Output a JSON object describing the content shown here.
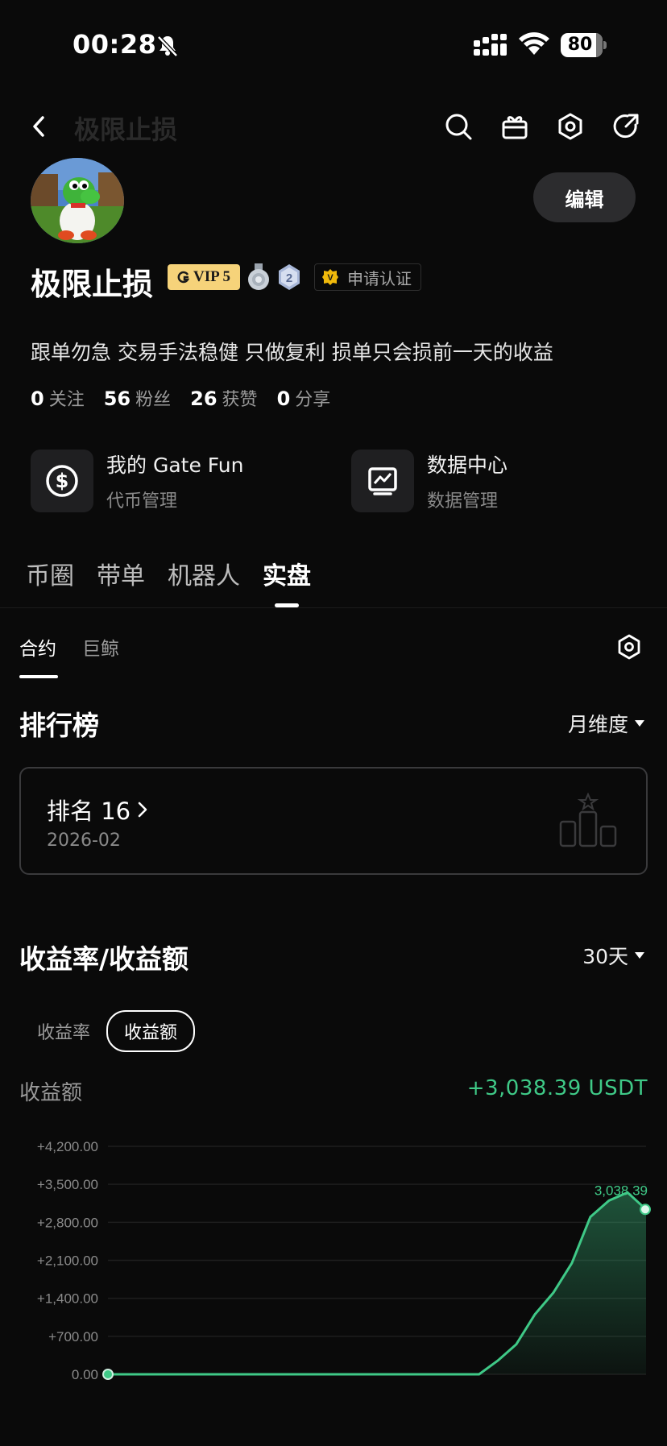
{
  "status_bar": {
    "time": "00:28",
    "battery": "80"
  },
  "header": {
    "title": "极限止损"
  },
  "profile": {
    "name": "极限止损",
    "vip_label": "VIP 5",
    "medal_2": "2",
    "verify_label": "申请认证",
    "edit_label": "编辑",
    "bio": "跟单勿急 交易手法稳健 只做复利 损单只会损前一天的收益",
    "stats": [
      {
        "num": "0",
        "label": "关注"
      },
      {
        "num": "56",
        "label": "粉丝"
      },
      {
        "num": "26",
        "label": "获赞"
      },
      {
        "num": "0",
        "label": "分享"
      }
    ]
  },
  "features": [
    {
      "title": "我的 Gate Fun",
      "sub": "代币管理",
      "icon": "dollar-coin-icon"
    },
    {
      "title": "数据中心",
      "sub": "数据管理",
      "icon": "chart-monitor-icon"
    }
  ],
  "tabs": [
    "币圈",
    "带单",
    "机器人",
    "实盘"
  ],
  "subtabs": [
    "合约",
    "巨鲸"
  ],
  "ranking": {
    "title": "排行榜",
    "period": "月维度",
    "rank_label": "排名 16",
    "date": "2026-02"
  },
  "pnl": {
    "title": "收益率/收益额",
    "range": "30天",
    "toggle_rate": "收益率",
    "toggle_amount": "收益额",
    "label": "收益额",
    "value": "+3,038.39 USDT"
  },
  "chart_data": {
    "type": "area",
    "ylabels": [
      "+4,200.00",
      "+3,500.00",
      "+2,800.00",
      "+2,100.00",
      "+1,400.00",
      "+700.00",
      "0.00"
    ],
    "ylim": [
      0,
      4200
    ],
    "values": [
      0,
      0,
      0,
      0,
      0,
      0,
      0,
      0,
      0,
      0,
      0,
      0,
      0,
      0,
      0,
      0,
      0,
      0,
      0,
      0,
      0,
      250,
      550,
      1100,
      1500,
      2050,
      2900,
      3200,
      3350,
      3038.39
    ],
    "end_label": "3,038.39",
    "color": "#3fc987"
  }
}
